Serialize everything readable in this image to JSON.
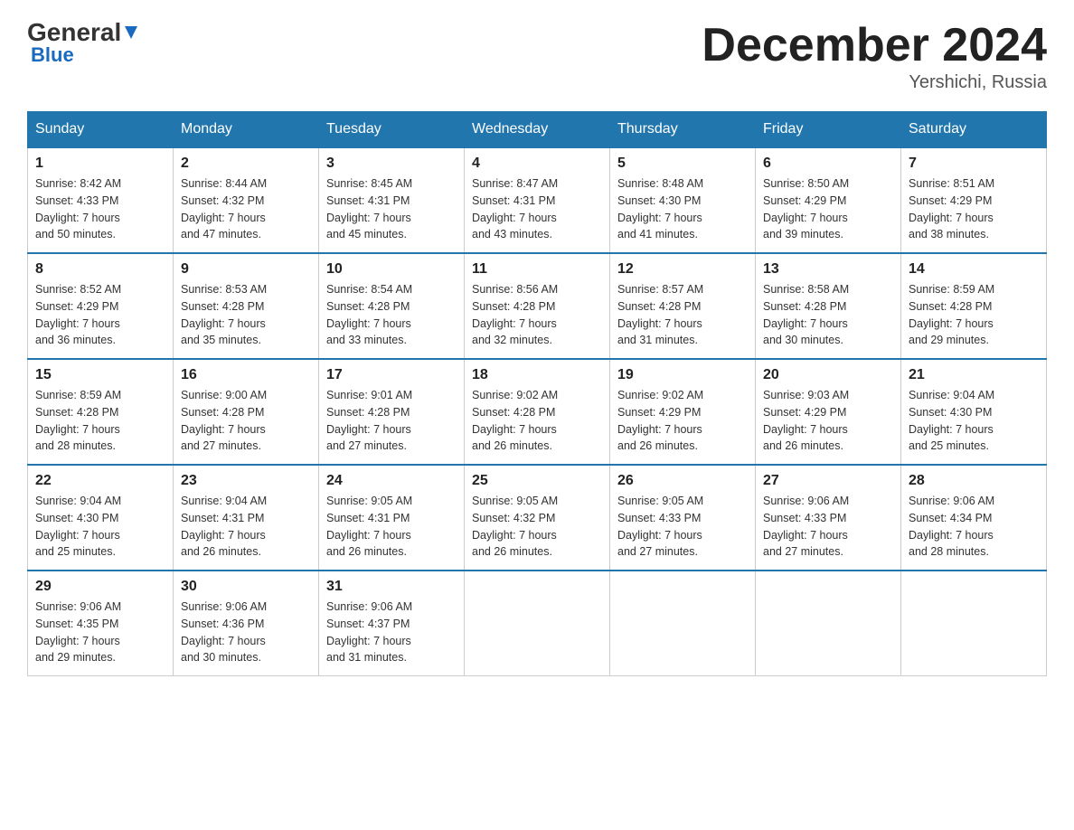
{
  "header": {
    "logo_general": "General",
    "logo_blue": "Blue",
    "month_title": "December 2024",
    "location": "Yershichi, Russia"
  },
  "colors": {
    "header_bg": "#2176ae",
    "header_text": "#ffffff",
    "border": "#2176ae"
  },
  "weekdays": [
    "Sunday",
    "Monday",
    "Tuesday",
    "Wednesday",
    "Thursday",
    "Friday",
    "Saturday"
  ],
  "weeks": [
    [
      {
        "day": "1",
        "sunrise": "8:42 AM",
        "sunset": "4:33 PM",
        "daylight": "7 hours and 50 minutes."
      },
      {
        "day": "2",
        "sunrise": "8:44 AM",
        "sunset": "4:32 PM",
        "daylight": "7 hours and 47 minutes."
      },
      {
        "day": "3",
        "sunrise": "8:45 AM",
        "sunset": "4:31 PM",
        "daylight": "7 hours and 45 minutes."
      },
      {
        "day": "4",
        "sunrise": "8:47 AM",
        "sunset": "4:31 PM",
        "daylight": "7 hours and 43 minutes."
      },
      {
        "day": "5",
        "sunrise": "8:48 AM",
        "sunset": "4:30 PM",
        "daylight": "7 hours and 41 minutes."
      },
      {
        "day": "6",
        "sunrise": "8:50 AM",
        "sunset": "4:29 PM",
        "daylight": "7 hours and 39 minutes."
      },
      {
        "day": "7",
        "sunrise": "8:51 AM",
        "sunset": "4:29 PM",
        "daylight": "7 hours and 38 minutes."
      }
    ],
    [
      {
        "day": "8",
        "sunrise": "8:52 AM",
        "sunset": "4:29 PM",
        "daylight": "7 hours and 36 minutes."
      },
      {
        "day": "9",
        "sunrise": "8:53 AM",
        "sunset": "4:28 PM",
        "daylight": "7 hours and 35 minutes."
      },
      {
        "day": "10",
        "sunrise": "8:54 AM",
        "sunset": "4:28 PM",
        "daylight": "7 hours and 33 minutes."
      },
      {
        "day": "11",
        "sunrise": "8:56 AM",
        "sunset": "4:28 PM",
        "daylight": "7 hours and 32 minutes."
      },
      {
        "day": "12",
        "sunrise": "8:57 AM",
        "sunset": "4:28 PM",
        "daylight": "7 hours and 31 minutes."
      },
      {
        "day": "13",
        "sunrise": "8:58 AM",
        "sunset": "4:28 PM",
        "daylight": "7 hours and 30 minutes."
      },
      {
        "day": "14",
        "sunrise": "8:59 AM",
        "sunset": "4:28 PM",
        "daylight": "7 hours and 29 minutes."
      }
    ],
    [
      {
        "day": "15",
        "sunrise": "8:59 AM",
        "sunset": "4:28 PM",
        "daylight": "7 hours and 28 minutes."
      },
      {
        "day": "16",
        "sunrise": "9:00 AM",
        "sunset": "4:28 PM",
        "daylight": "7 hours and 27 minutes."
      },
      {
        "day": "17",
        "sunrise": "9:01 AM",
        "sunset": "4:28 PM",
        "daylight": "7 hours and 27 minutes."
      },
      {
        "day": "18",
        "sunrise": "9:02 AM",
        "sunset": "4:28 PM",
        "daylight": "7 hours and 26 minutes."
      },
      {
        "day": "19",
        "sunrise": "9:02 AM",
        "sunset": "4:29 PM",
        "daylight": "7 hours and 26 minutes."
      },
      {
        "day": "20",
        "sunrise": "9:03 AM",
        "sunset": "4:29 PM",
        "daylight": "7 hours and 26 minutes."
      },
      {
        "day": "21",
        "sunrise": "9:04 AM",
        "sunset": "4:30 PM",
        "daylight": "7 hours and 25 minutes."
      }
    ],
    [
      {
        "day": "22",
        "sunrise": "9:04 AM",
        "sunset": "4:30 PM",
        "daylight": "7 hours and 25 minutes."
      },
      {
        "day": "23",
        "sunrise": "9:04 AM",
        "sunset": "4:31 PM",
        "daylight": "7 hours and 26 minutes."
      },
      {
        "day": "24",
        "sunrise": "9:05 AM",
        "sunset": "4:31 PM",
        "daylight": "7 hours and 26 minutes."
      },
      {
        "day": "25",
        "sunrise": "9:05 AM",
        "sunset": "4:32 PM",
        "daylight": "7 hours and 26 minutes."
      },
      {
        "day": "26",
        "sunrise": "9:05 AM",
        "sunset": "4:33 PM",
        "daylight": "7 hours and 27 minutes."
      },
      {
        "day": "27",
        "sunrise": "9:06 AM",
        "sunset": "4:33 PM",
        "daylight": "7 hours and 27 minutes."
      },
      {
        "day": "28",
        "sunrise": "9:06 AM",
        "sunset": "4:34 PM",
        "daylight": "7 hours and 28 minutes."
      }
    ],
    [
      {
        "day": "29",
        "sunrise": "9:06 AM",
        "sunset": "4:35 PM",
        "daylight": "7 hours and 29 minutes."
      },
      {
        "day": "30",
        "sunrise": "9:06 AM",
        "sunset": "4:36 PM",
        "daylight": "7 hours and 30 minutes."
      },
      {
        "day": "31",
        "sunrise": "9:06 AM",
        "sunset": "4:37 PM",
        "daylight": "7 hours and 31 minutes."
      },
      null,
      null,
      null,
      null
    ]
  ]
}
